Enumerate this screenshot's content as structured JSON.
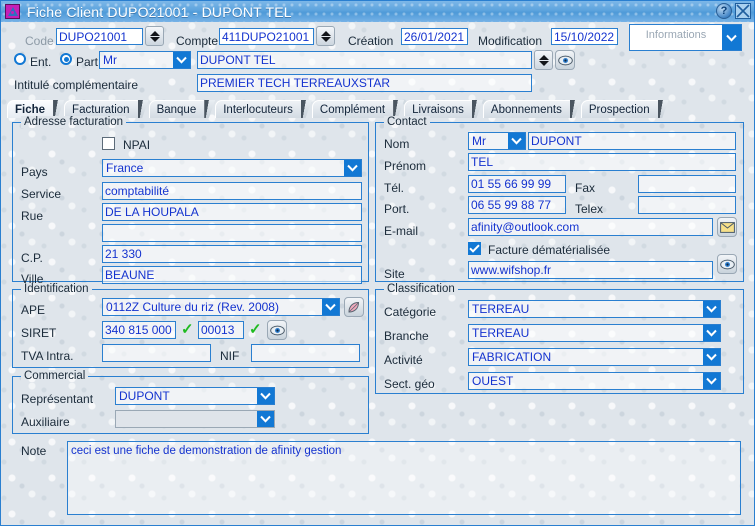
{
  "window": {
    "title": "Fiche Client DUPO21001 - DUPONT TEL",
    "app_icon": "afinity-app-icon",
    "help_label": "?",
    "close_label": "close-icon"
  },
  "header": {
    "code_label": "Code",
    "code_value": "DUPO21001",
    "compte_label": "Compte",
    "compte_value": "411DUPO21001",
    "creation_label": "Création",
    "creation_value": "26/01/2021",
    "modification_label": "Modification",
    "modification_value": "15/10/2022",
    "informations_label": "Informations",
    "informations_label2": "",
    "ent_label": "Ent.",
    "part_label": "Part",
    "civilite_value": "Mr",
    "nom_value": "DUPONT TEL",
    "intitule_label": "Intitulé complémentaire",
    "intitule_value": "PREMIER TECH TERREAUXSTAR"
  },
  "tabs": [
    {
      "label": "Fiche",
      "active": true
    },
    {
      "label": "Facturation",
      "active": false
    },
    {
      "label": "Banque",
      "active": false
    },
    {
      "label": "Interlocuteurs",
      "active": false
    },
    {
      "label": "Complément",
      "active": false
    },
    {
      "label": "Livraisons",
      "active": false
    },
    {
      "label": "Abonnements",
      "active": false
    },
    {
      "label": "Prospection",
      "active": false
    }
  ],
  "adresse": {
    "title": "Adresse facturation",
    "npai_label": "NPAI",
    "npai_checked": false,
    "pays_label": "Pays",
    "pays_value": "France",
    "service_label": "Service",
    "service_value": "comptabilité",
    "rue_label": "Rue",
    "rue_value": "DE LA HOUPALA",
    "rue2_value": "",
    "cp_label": "C.P.",
    "cp_value": "21 330",
    "ville_label": "Ville",
    "ville_value": "BEAUNE"
  },
  "contact": {
    "title": "Contact",
    "nom_label": "Nom",
    "nom_civilite": "Mr",
    "nom_value": "DUPONT",
    "prenom_label": "Prénom",
    "prenom_value": "TEL",
    "tel_label": "Tél.",
    "tel_value": "01 55 66 99 99",
    "fax_label": "Fax",
    "fax_value": "",
    "port_label": "Port.",
    "port_value": "06 55 99 88 77",
    "telex_label": "Telex",
    "telex_value": "",
    "email_label": "E-mail",
    "email_value": "afinity@outlook.com",
    "email_icon": "envelope-icon",
    "facture_demat_label": "Facture dématérialisée",
    "facture_demat_checked": true,
    "site_label": "Site",
    "site_value": "www.wifshop.fr",
    "site_icon": "eye-icon"
  },
  "identification": {
    "title": "Identification",
    "ape_label": "APE",
    "ape_value": "0112Z Culture du riz (Rev. 2008)",
    "ape_icon": "pencil-icon",
    "siret_label": "SIRET",
    "siret_value": "340 815 000",
    "siret_suffix": "00013",
    "siret_valid_icon": "check-icon",
    "siret_eye_icon": "eye-icon",
    "tva_label": "TVA Intra.",
    "tva_value": "",
    "nif_label": "NIF",
    "nif_value": ""
  },
  "classification": {
    "title": "Classification",
    "categorie_label": "Catégorie",
    "categorie_value": "TERREAU",
    "branche_label": "Branche",
    "branche_value": "TERREAU",
    "activite_label": "Activité",
    "activite_value": "FABRICATION",
    "sect_geo_label": "Sect. géo",
    "sect_geo_value": "OUEST"
  },
  "commercial": {
    "title": "Commercial",
    "representant_label": "Représentant",
    "representant_value": "DUPONT",
    "auxiliaire_label": "Auxiliaire",
    "auxiliaire_value": ""
  },
  "note": {
    "label": "Note",
    "value": "ceci est une fiche de demonstration de afinity gestion"
  },
  "colors": {
    "accent_blue": "#1278d4",
    "field_border": "#2a7fd0",
    "field_text": "#1433cf",
    "titlebar": "#5ca3dd",
    "check_green": "#1fbb20",
    "app_icon_magenta": "#c51fb8"
  }
}
